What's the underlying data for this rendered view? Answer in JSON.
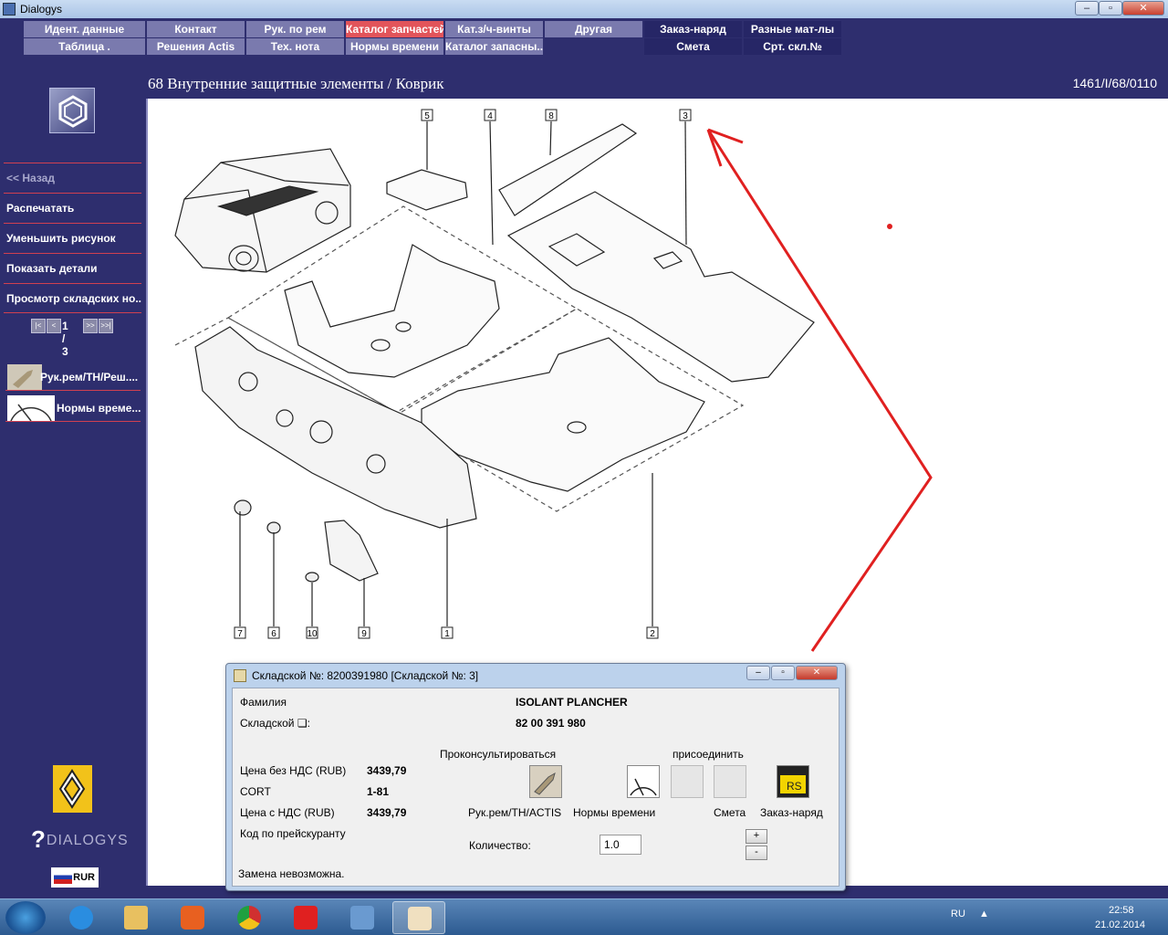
{
  "window": {
    "title": "Dialogys"
  },
  "menu": {
    "row1": [
      "Идент. данные",
      "Контакт",
      "Рук. по рем",
      "Каталог запчастей",
      "Кат.з/ч-винты",
      "Другая",
      "Заказ-наряд",
      "Разные мат-лы"
    ],
    "row2": [
      "Таблица .",
      "Решения Actis",
      "Тех. нота",
      "Нормы времени",
      "Каталог запасны...",
      "Смета",
      "Срт. скл.№"
    ],
    "active": "Каталог запчастей"
  },
  "header": {
    "breadcrumb": "68 Внутренние защитные элементы / Коврик",
    "ref": "1461/I/68/0110"
  },
  "sidebar": {
    "items": [
      {
        "label": "<< Назад"
      },
      {
        "label": "Распечатать"
      },
      {
        "label": "Уменьшить рисунок"
      },
      {
        "label": "Показать детали"
      },
      {
        "label": "Просмотр складских но..."
      }
    ],
    "pager": {
      "current": "1",
      "total": "3",
      "text": "1 / 3"
    },
    "links": [
      {
        "label": "Рук.рем/ТН/Реш...."
      },
      {
        "label": "Нормы време..."
      }
    ],
    "brand": "DIALOGYS",
    "currency": "RUR"
  },
  "diagram": {
    "callouts": [
      "5",
      "4",
      "8",
      "3",
      "7",
      "6",
      "10",
      "9",
      "1",
      "2"
    ]
  },
  "dialog": {
    "title": "Складской №: 8200391980 [Складской №: 3]",
    "family_label": "Фамилия",
    "family_value": "ISOLANT PLANCHER",
    "part_label": "Складской ❏:",
    "part_value": "82 00 391 980",
    "consult_label": "Проконсультироваться",
    "attach_label": "присоединить",
    "price_net_label": "Цена без НДС (RUB)",
    "price_net_value": "3439,79",
    "cort_label": "CORT",
    "cort_value": "1-81",
    "price_gross_label": "Цена с НДС (RUB)",
    "price_gross_value": "3439,79",
    "pricelist_label": "Код по прейскуранту",
    "actions": [
      "Рук.рем/ТН/ACTIS",
      "Нормы времени",
      "Смета",
      "Заказ-наряд"
    ],
    "qty_label": "Количество:",
    "qty_value": "1.0",
    "plus": "+",
    "minus": "-",
    "status": "Замена невозможна."
  },
  "taskbar": {
    "lang": "RU",
    "time": "22:58",
    "date": "21.02.2014"
  },
  "colors": {
    "background": "#2e2e6e",
    "menu_light": "#7a7aae",
    "menu_active": "#e2545a",
    "separator": "#d04050",
    "annotation": "#e02020"
  }
}
